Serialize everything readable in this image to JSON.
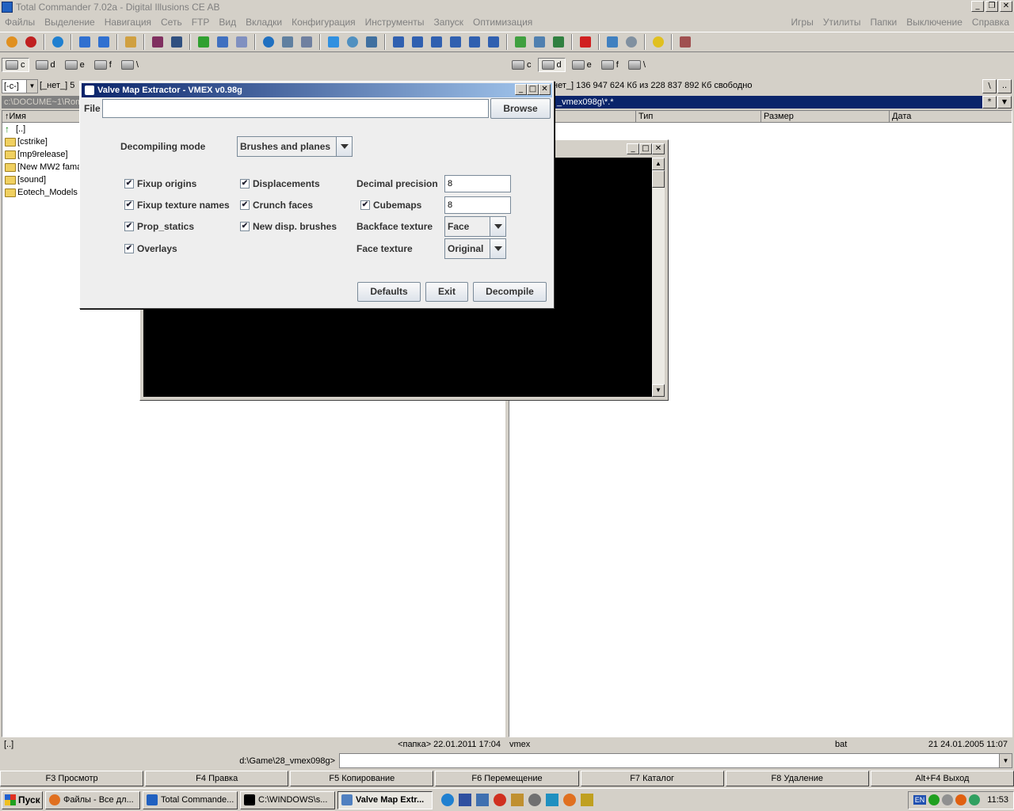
{
  "window": {
    "title": "Total Commander 7.02a - Digital Illusions CE AB"
  },
  "menu": {
    "left": [
      "Файлы",
      "Выделение",
      "Навигация",
      "Сеть",
      "FTP",
      "Вид",
      "Вкладки",
      "Конфигурация",
      "Инструменты",
      "Запуск",
      "Оптимизация"
    ],
    "right": [
      "Игры",
      "Утилиты",
      "Папки",
      "Выключение",
      "Справка"
    ]
  },
  "left_panel": {
    "drives": [
      "c",
      "d",
      "e",
      "f",
      "\\"
    ],
    "drive_combo": "[-c-]",
    "free_info": "[_нет_]  5",
    "path": "c:\\DOCUME~1\\Roma",
    "col_name": "↑Имя",
    "files": [
      "[..]",
      "[cstrike]",
      "[mp9release]",
      "[New MW2 fama",
      "[sound]",
      "Eotech_Models r"
    ],
    "status_left": "[..]",
    "status_right": "<папка> 22.01.2011 17:04"
  },
  "right_panel": {
    "drives": [
      "c",
      "d",
      "e",
      "f",
      "\\"
    ],
    "free_info": "нет_]  136 947 624 Кб из 228 837 892 Кб свободно",
    "path": "_vmex098g\\*.*",
    "btn_root": "\\",
    "btn_up": "..",
    "btn_star": "*",
    "col_type": "Тип",
    "col_size": "Размер",
    "col_date": "Дата",
    "status_name": "vmex",
    "status_ext": "bat",
    "status_info": "21  24.01.2005 11:07"
  },
  "cmdline": {
    "path": "d:\\Game\\28_vmex098g>"
  },
  "fkeys": [
    "F3 Просмотр",
    "F4 Правка",
    "F5 Копирование",
    "F6 Перемещение",
    "F7 Каталог",
    "F8 Удаление",
    "Alt+F4 Выход"
  ],
  "dialog": {
    "title": "Valve Map Extractor - VMEX v0.98g",
    "file_label": "File",
    "file_value": "",
    "browse": "Browse",
    "mode_label": "Decompiling mode",
    "mode_value": "Brushes and planes",
    "checks_col1": [
      "Fixup origins",
      "Fixup texture names",
      "Prop_statics",
      "Overlays"
    ],
    "checks_col2": [
      "Displacements",
      "Crunch faces",
      "New disp. brushes"
    ],
    "decimal_label": "Decimal precision",
    "decimal_value": "8",
    "cubemaps_label": "Cubemaps",
    "cubemaps_value": "8",
    "backface_label": "Backface texture",
    "backface_value": "Face",
    "face_label": "Face texture",
    "face_value": "Original",
    "defaults": "Defaults",
    "exit": "Exit",
    "decompile": "Decompile"
  },
  "taskbar": {
    "start": "Пуск",
    "tasks": [
      "Файлы - Все дл...",
      "Total Commande...",
      "C:\\WINDOWS\\s...",
      "Valve Map Extr..."
    ],
    "lang": "EN",
    "clock": "11:53"
  }
}
